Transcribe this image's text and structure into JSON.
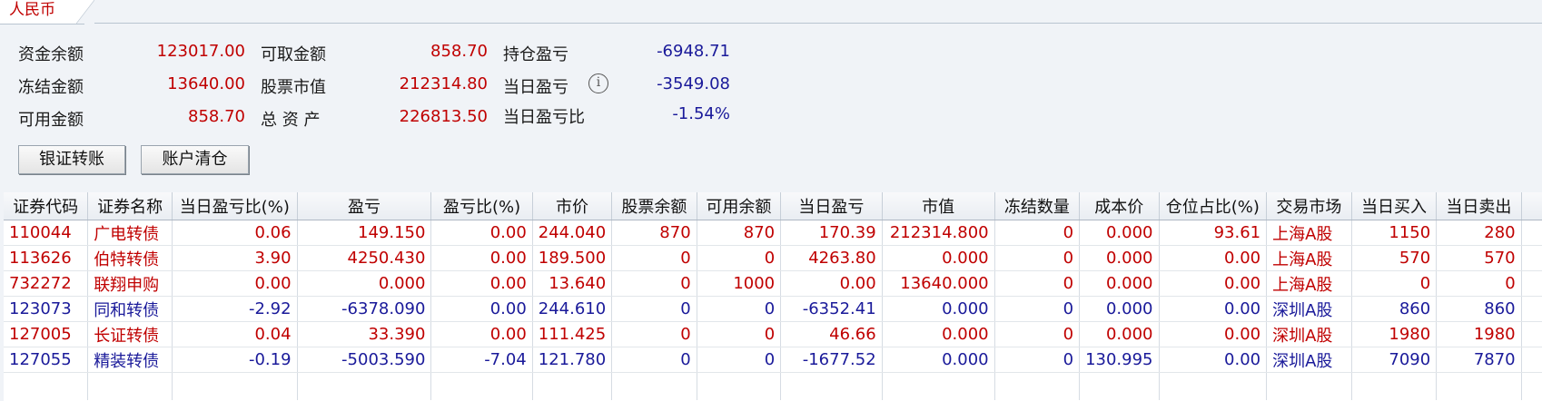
{
  "tab": {
    "label": "人民币"
  },
  "summary": {
    "fund_balance_label": "资金余额",
    "fund_balance": "123017.00",
    "frozen_amount_label": "冻结金额",
    "frozen_amount": "13640.00",
    "available_amount_label": "可用金额",
    "available_amount": "858.70",
    "withdrawable_label": "可取金额",
    "withdrawable": "858.70",
    "stock_value_label": "股票市值",
    "stock_value": "212314.80",
    "total_assets_label": "总 资 产",
    "total_assets": "226813.50",
    "holding_pl_label": "持仓盈亏",
    "holding_pl": "-6948.71",
    "daily_pl_label": "当日盈亏",
    "daily_pl": "-3549.08",
    "daily_pl_ratio_label": "当日盈亏比",
    "daily_pl_ratio": "-1.54%",
    "info_icon": "info-icon"
  },
  "buttons": {
    "bank_transfer": "银证转账",
    "clear_account": "账户清仓"
  },
  "table": {
    "headers": [
      "证券代码",
      "证券名称",
      "当日盈亏比(%)",
      "盈亏",
      "盈亏比(%)",
      "市价",
      "股票余额",
      "可用余额",
      "当日盈亏",
      "市值",
      "冻结数量",
      "成本价",
      "仓位占比(%)",
      "交易市场",
      "当日买入",
      "当日卖出"
    ],
    "rows": [
      {
        "color": "#c00000",
        "cells": [
          "110044",
          "广电转债",
          "0.06",
          "149.150",
          "0.00",
          "244.040",
          "870",
          "870",
          "170.39",
          "212314.800",
          "0",
          "0.000",
          "93.61",
          "上海A股",
          "1150",
          "280"
        ]
      },
      {
        "color": "#c00000",
        "cells": [
          "113626",
          "伯特转债",
          "3.90",
          "4250.430",
          "0.00",
          "189.500",
          "0",
          "0",
          "4263.80",
          "0.000",
          "0",
          "0.000",
          "0.00",
          "上海A股",
          "570",
          "570"
        ]
      },
      {
        "color": "#c00000",
        "cells": [
          "732272",
          "联翔申购",
          "0.00",
          "0.000",
          "0.00",
          "13.640",
          "0",
          "1000",
          "0.00",
          "13640.000",
          "0",
          "0.000",
          "0.00",
          "上海A股",
          "0",
          "0"
        ]
      },
      {
        "color": "#1a1a9a",
        "cells": [
          "123073",
          "同和转债",
          "-2.92",
          "-6378.090",
          "0.00",
          "244.610",
          "0",
          "0",
          "-6352.41",
          "0.000",
          "0",
          "0.000",
          "0.00",
          "深圳A股",
          "860",
          "860"
        ]
      },
      {
        "color": "#c00000",
        "cells": [
          "127005",
          "长证转债",
          "0.04",
          "33.390",
          "0.00",
          "111.425",
          "0",
          "0",
          "46.66",
          "0.000",
          "0",
          "0.000",
          "0.00",
          "深圳A股",
          "1980",
          "1980"
        ]
      },
      {
        "color": "#1a1a9a",
        "cells": [
          "127055",
          "精装转债",
          "-0.19",
          "-5003.590",
          "-7.04",
          "121.780",
          "0",
          "0",
          "-1677.52",
          "0.000",
          "0",
          "130.995",
          "0.00",
          "深圳A股",
          "7090",
          "7870"
        ]
      }
    ]
  }
}
